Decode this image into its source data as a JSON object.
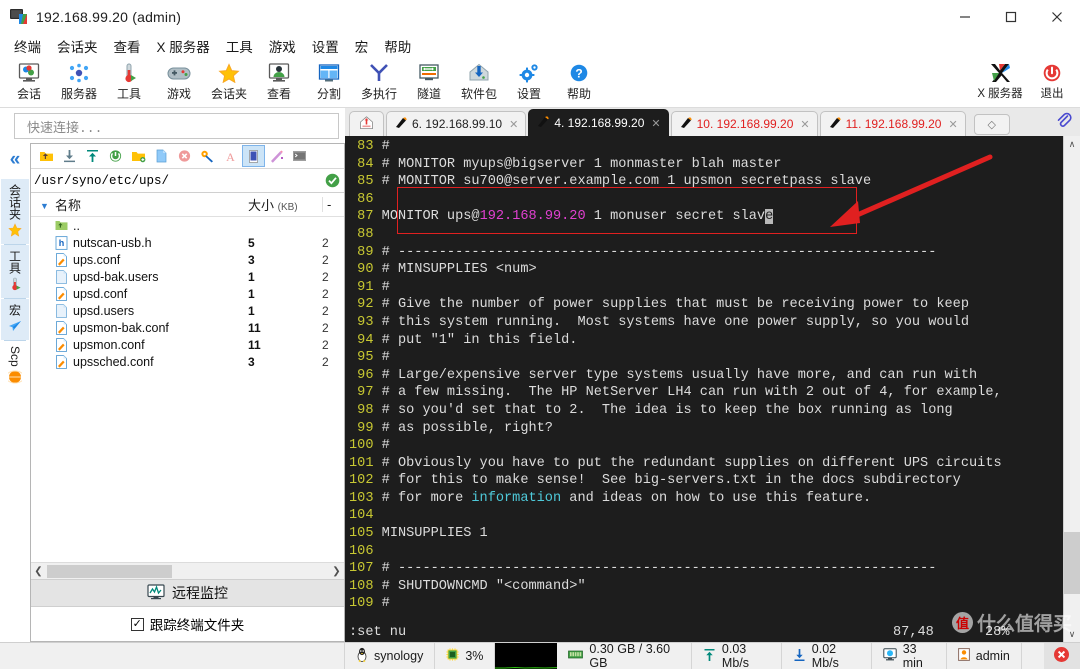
{
  "window": {
    "title": "192.168.99.20 (admin)",
    "icon": "mobaxterm-icon",
    "controls": [
      {
        "name": "minimize-button",
        "glyph": "—"
      },
      {
        "name": "maximize-button",
        "glyph": "☐"
      },
      {
        "name": "close-button",
        "glyph": "✕"
      }
    ]
  },
  "menubar": {
    "items": [
      {
        "name": "menu-terminal",
        "label": "终端"
      },
      {
        "name": "menu-sessions",
        "label": "会话夹"
      },
      {
        "name": "menu-view",
        "label": "查看"
      },
      {
        "name": "menu-xserver",
        "label": "X 服务器"
      },
      {
        "name": "menu-tools",
        "label": "工具"
      },
      {
        "name": "menu-games",
        "label": "游戏"
      },
      {
        "name": "menu-settings",
        "label": "设置"
      },
      {
        "name": "menu-macros",
        "label": "宏"
      },
      {
        "name": "menu-help",
        "label": "帮助"
      }
    ]
  },
  "toolbar": {
    "buttons": [
      {
        "name": "toolbar-session",
        "label": "会话",
        "icon": "session-icon"
      },
      {
        "name": "toolbar-servers",
        "label": "服务器",
        "icon": "servers-icon"
      },
      {
        "name": "toolbar-tools",
        "label": "工具",
        "icon": "tools-icon"
      },
      {
        "name": "toolbar-games",
        "label": "游戏",
        "icon": "gamepad-icon"
      },
      {
        "name": "toolbar-sessions-folder",
        "label": "会话夹",
        "icon": "star-icon"
      },
      {
        "name": "toolbar-view",
        "label": "查看",
        "icon": "view-icon"
      },
      {
        "name": "toolbar-split",
        "label": "分割",
        "icon": "split-icon"
      },
      {
        "name": "toolbar-multiexec",
        "label": "多执行",
        "icon": "multiexec-icon"
      },
      {
        "name": "toolbar-tunnel",
        "label": "隧道",
        "icon": "tunnel-icon"
      },
      {
        "name": "toolbar-packages",
        "label": "软件包",
        "icon": "package-icon"
      },
      {
        "name": "toolbar-settings",
        "label": "设置",
        "icon": "gear-icon"
      },
      {
        "name": "toolbar-help",
        "label": "帮助",
        "icon": "help-icon"
      }
    ],
    "right_buttons": [
      {
        "name": "toolbar-xserver",
        "label": "X 服务器",
        "icon": "xserver-icon"
      },
      {
        "name": "toolbar-exit",
        "label": "退出",
        "icon": "power-icon"
      }
    ]
  },
  "sidebar": {
    "quick_connect_placeholder": "快速连接...",
    "collapse_icon": "«",
    "vtabs": [
      {
        "name": "vtab-sessions",
        "label": "会话夹",
        "icon": "star-icon",
        "active": false
      },
      {
        "name": "vtab-tools",
        "label": "工具",
        "icon": "tools-icon",
        "active": false
      },
      {
        "name": "vtab-macros",
        "label": "宏",
        "icon": "paper-plane-icon",
        "active": false
      },
      {
        "name": "vtab-scp",
        "label": "Scp",
        "icon": "globe-icon",
        "active": true
      }
    ],
    "file_toolbar": [
      {
        "name": "parent-folder-icon",
        "selected": false
      },
      {
        "name": "download-icon",
        "selected": false
      },
      {
        "name": "upload-icon",
        "selected": false
      },
      {
        "name": "refresh-icon",
        "selected": false
      },
      {
        "name": "new-folder-icon",
        "selected": false
      },
      {
        "name": "new-file-icon",
        "selected": false
      },
      {
        "name": "delete-icon",
        "selected": false
      },
      {
        "name": "permissions-icon",
        "selected": false
      },
      {
        "name": "text-mode-icon",
        "selected": false
      },
      {
        "name": "binary-mode-icon",
        "selected": true
      },
      {
        "name": "follow-icon",
        "selected": false
      },
      {
        "name": "terminal-icon",
        "selected": false
      }
    ],
    "path": "/usr/syno/etc/ups/",
    "path_ok_icon": "check-circle-icon",
    "columns": [
      {
        "name": "column-name",
        "label": "名称"
      },
      {
        "name": "column-size",
        "label": "大小",
        "unit": "(KB)"
      },
      {
        "name": "column-date",
        "label": "-"
      }
    ],
    "files": [
      {
        "name": "..",
        "size": "",
        "date": "",
        "icon": "parent-folder-icon"
      },
      {
        "name": "nutscan-usb.h",
        "size": "5",
        "date": "2",
        "icon": "header-file-icon"
      },
      {
        "name": "ups.conf",
        "size": "3",
        "date": "2",
        "icon": "conf-file-icon"
      },
      {
        "name": "upsd-bak.users",
        "size": "1",
        "date": "2",
        "icon": "plain-file-icon"
      },
      {
        "name": "upsd.conf",
        "size": "1",
        "date": "2",
        "icon": "conf-file-icon"
      },
      {
        "name": "upsd.users",
        "size": "1",
        "date": "2",
        "icon": "plain-file-icon"
      },
      {
        "name": "upsmon-bak.conf",
        "size": "11",
        "date": "2",
        "icon": "conf-file-icon"
      },
      {
        "name": "upsmon.conf",
        "size": "11",
        "date": "2",
        "icon": "conf-file-icon"
      },
      {
        "name": "upssched.conf",
        "size": "3",
        "date": "2",
        "icon": "conf-file-icon"
      }
    ],
    "remote_monitor_label": "远程监控",
    "remote_monitor_icon": "monitor-chart-icon",
    "follow_terminal_label": "跟踪终端文件夹",
    "follow_terminal_checked": "✓"
  },
  "tabs": {
    "home_icon": "home-icon",
    "items": [
      {
        "name": "tab-home",
        "label": "",
        "active": false,
        "home": true,
        "red": false
      },
      {
        "name": "tab-session-6",
        "label": "6. 192.168.99.10",
        "active": false,
        "home": false,
        "red": false
      },
      {
        "name": "tab-session-4",
        "label": "4. 192.168.99.20",
        "active": true,
        "home": false,
        "red": false
      },
      {
        "name": "tab-session-10",
        "label": "10. 192.168.99.20",
        "active": false,
        "home": false,
        "red": true
      },
      {
        "name": "tab-session-11",
        "label": "11. 192.168.99.20",
        "active": false,
        "home": false,
        "red": true
      }
    ],
    "new_tab_glyph": "◇",
    "clip_icon": "paperclip-icon"
  },
  "terminal": {
    "lines": [
      {
        "no": "83",
        "text": "#"
      },
      {
        "no": "84",
        "text": "# MONITOR myups@bigserver 1 monmaster blah master"
      },
      {
        "no": "85",
        "text": "# MONITOR su700@server.example.com 1 upsmon secretpass slave"
      },
      {
        "no": "86",
        "text": ""
      },
      {
        "no": "87",
        "text": "MONITOR ups@192.168.99.20 1 monuser secret slave",
        "highlight": true
      },
      {
        "no": "88",
        "text": ""
      },
      {
        "no": "89",
        "text": "# ------------------------------------------------------------------"
      },
      {
        "no": "90",
        "text": "# MINSUPPLIES <num>"
      },
      {
        "no": "91",
        "text": "#"
      },
      {
        "no": "92",
        "text": "# Give the number of power supplies that must be receiving power to keep"
      },
      {
        "no": "93",
        "text": "# this system running.  Most systems have one power supply, so you would"
      },
      {
        "no": "94",
        "text": "# put \"1\" in this field."
      },
      {
        "no": "95",
        "text": "#"
      },
      {
        "no": "96",
        "text": "# Large/expensive server type systems usually have more, and can run with"
      },
      {
        "no": "97",
        "text": "# a few missing.  The HP NetServer LH4 can run with 2 out of 4, for example,"
      },
      {
        "no": "98",
        "text": "# so you'd set that to 2.  The idea is to keep the box running as long"
      },
      {
        "no": "99",
        "text": "# as possible, right?"
      },
      {
        "no": "100",
        "text": "#"
      },
      {
        "no": "101",
        "text": "# Obviously you have to put the redundant supplies on different UPS circuits"
      },
      {
        "no": "102",
        "text": "# for this to make sense!  See big-servers.txt in the docs subdirectory"
      },
      {
        "no": "103",
        "text": "# for more information and ideas on how to use this feature."
      },
      {
        "no": "104",
        "text": ""
      },
      {
        "no": "105",
        "text": "MINSUPPLIES 1"
      },
      {
        "no": "106",
        "text": ""
      },
      {
        "no": "107",
        "text": "# ------------------------------------------------------------------"
      },
      {
        "no": "108",
        "text": "# SHUTDOWNCMD \"<command>\""
      },
      {
        "no": "109",
        "text": "#"
      }
    ],
    "edited_line": {
      "prefix": "MONITOR ups@",
      "ip": "192.168.99.20",
      "suffix": " 1 monuser secret slav",
      "cursor_char": "e"
    },
    "status": {
      "command": ":set nu",
      "position": "87,48",
      "percent": "28%"
    },
    "scroll": {
      "up_glyph": "∧",
      "down_glyph": "∨"
    }
  },
  "statusbar": {
    "cells": [
      {
        "name": "status-host",
        "icon": "linux-penguin-icon",
        "label": "synology"
      },
      {
        "name": "status-cpu",
        "icon": "cpu-icon",
        "label": "3%"
      },
      {
        "name": "status-ram",
        "icon": "ram-icon",
        "label": "0.30 GB / 3.60 GB"
      },
      {
        "name": "status-upload",
        "icon": "upload-icon",
        "label": "0.03 Mb/s"
      },
      {
        "name": "status-download",
        "icon": "download-icon",
        "label": "0.02 Mb/s"
      },
      {
        "name": "status-uptime",
        "icon": "monitor-icon",
        "label": "33 min"
      },
      {
        "name": "status-user",
        "icon": "user-icon",
        "label": "admin"
      }
    ],
    "close_icon": "close-circle-icon",
    "graph_name": "cpu-graph"
  },
  "watermark": {
    "text": "什么值得买",
    "badge": "值"
  },
  "colors": {
    "accent": "#2d7dd2",
    "terminal_bg": "#1d1d1d",
    "line_number": "#c8c832",
    "magenta": "#e040d0",
    "cyan": "#4ec9d9",
    "annotation_red": "#e02020",
    "tab_red": "#e02020"
  }
}
